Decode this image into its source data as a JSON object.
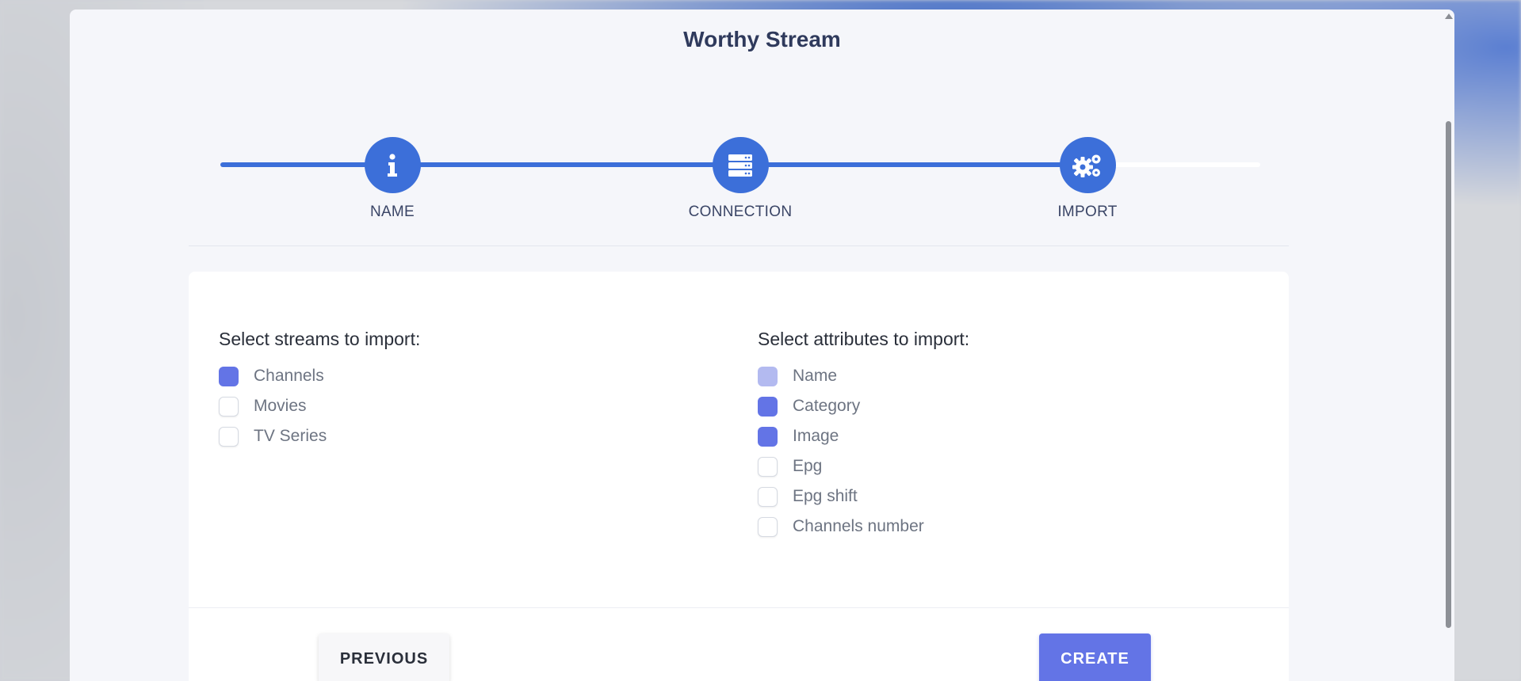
{
  "modal": {
    "title": "Worthy Stream"
  },
  "stepper": {
    "steps": [
      {
        "label": "NAME",
        "icon": "info-icon"
      },
      {
        "label": "CONNECTION",
        "icon": "server-icon"
      },
      {
        "label": "IMPORT",
        "icon": "gears-icon"
      }
    ],
    "progress": 0.84
  },
  "streams": {
    "heading": "Select streams to import:",
    "options": [
      {
        "label": "Channels",
        "checked": true
      },
      {
        "label": "Movies",
        "checked": false
      },
      {
        "label": "TV Series",
        "checked": false
      }
    ]
  },
  "attributes": {
    "heading": "Select attributes to import:",
    "options": [
      {
        "label": "Name",
        "checked": true,
        "disabled": true
      },
      {
        "label": "Category",
        "checked": true
      },
      {
        "label": "Image",
        "checked": true
      },
      {
        "label": "Epg",
        "checked": false
      },
      {
        "label": "Epg shift",
        "checked": false
      },
      {
        "label": "Channels number",
        "checked": false
      }
    ]
  },
  "buttons": {
    "previous": "PREVIOUS",
    "create": "CREATE"
  },
  "colors": {
    "accent": "#3c6fd9",
    "checkbox": "#6374e6",
    "checkbox_disabled": "#b3baf0"
  }
}
